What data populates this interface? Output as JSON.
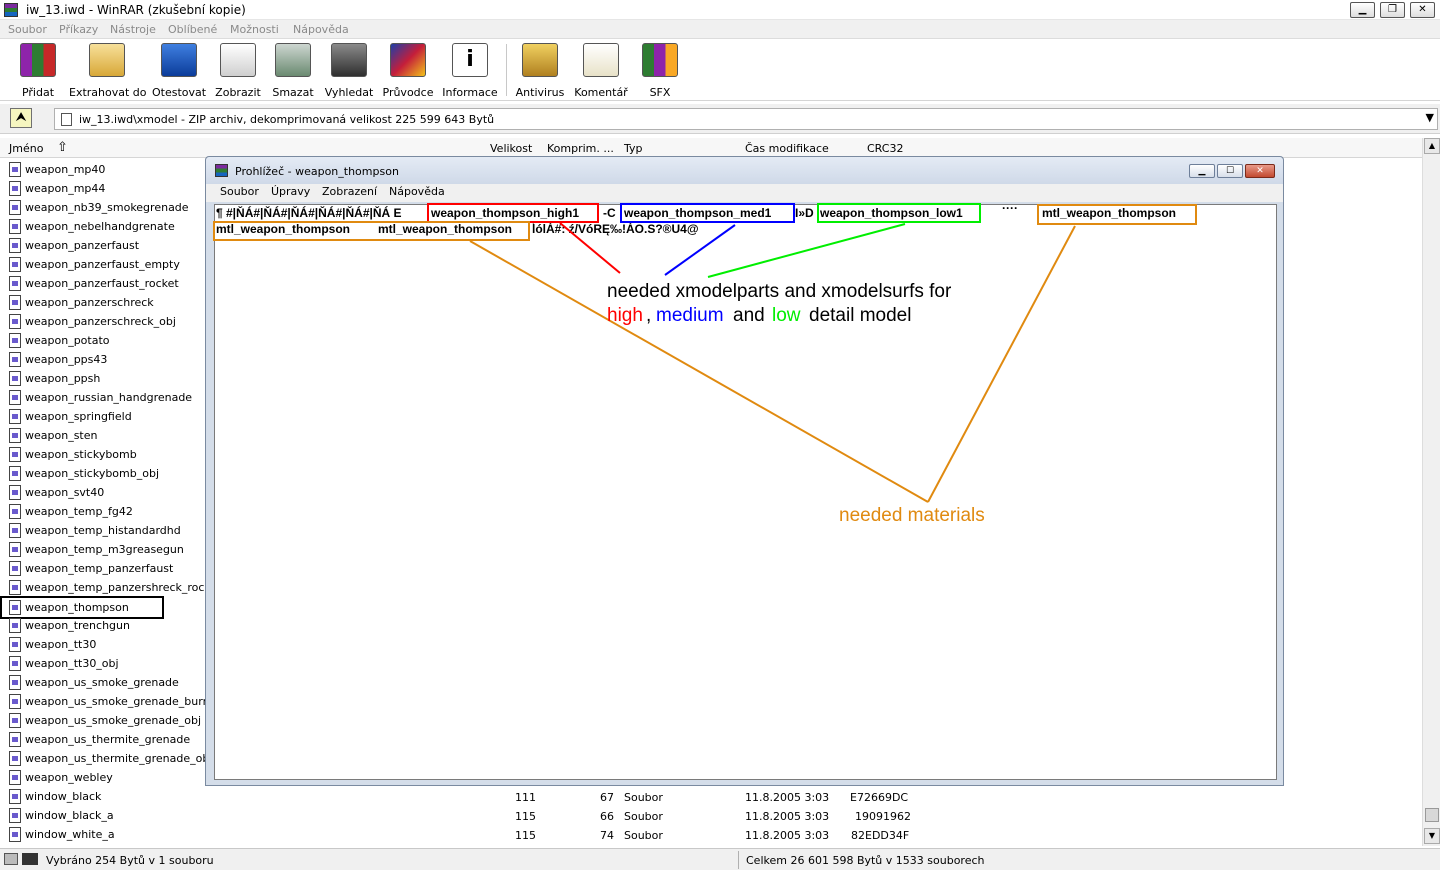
{
  "window": {
    "title": "iw_13.iwd - WinRAR (zkušební kopie)"
  },
  "menu": [
    "Soubor",
    "Příkazy",
    "Nástroje",
    "Oblíbené",
    "Možnosti",
    "Nápověda"
  ],
  "toolbar": [
    {
      "label": "Přidat",
      "icon": "add-books-icon"
    },
    {
      "label": "Extrahovat do",
      "icon": "extract-folder-icon"
    },
    {
      "label": "Otestovat",
      "icon": "test-check-icon"
    },
    {
      "label": "Zobrazit",
      "icon": "view-glasses-icon"
    },
    {
      "label": "Smazat",
      "icon": "delete-recycle-icon"
    },
    {
      "label": "Vyhledat",
      "icon": "find-binoculars-icon"
    },
    {
      "label": "Průvodce",
      "icon": "wizard-icon"
    },
    {
      "label": "Informace",
      "icon": "info-icon"
    },
    {
      "label": "Antivirus",
      "icon": "antivirus-icon"
    },
    {
      "label": "Komentář",
      "icon": "comment-pen-icon"
    },
    {
      "label": "SFX",
      "icon": "sfx-icon"
    }
  ],
  "path": {
    "text": "iw_13.iwd\\xmodel - ZIP archiv, dekomprimovaná velikost 225 599 643 Bytů"
  },
  "columns": {
    "name": "Jméno",
    "size": "Velikost",
    "packed": "Komprim. ...",
    "type": "Typ",
    "modified": "Čas modifikace",
    "crc": "CRC32"
  },
  "files": [
    "weapon_mp40",
    "weapon_mp44",
    "weapon_nb39_smokegrenade",
    "weapon_nebelhandgrenate",
    "weapon_panzerfaust",
    "weapon_panzerfaust_empty",
    "weapon_panzerfaust_rocket",
    "weapon_panzerschreck",
    "weapon_panzerschreck_obj",
    "weapon_potato",
    "weapon_pps43",
    "weapon_ppsh",
    "weapon_russian_handgrenade",
    "weapon_springfield",
    "weapon_sten",
    "weapon_stickybomb",
    "weapon_stickybomb_obj",
    "weapon_svt40",
    "weapon_temp_fg42",
    "weapon_temp_histandardhd",
    "weapon_temp_m3greasegun",
    "weapon_temp_panzerfaust",
    "weapon_temp_panzershreck_rocket",
    "weapon_thompson",
    "weapon_trenchgun",
    "weapon_tt30",
    "weapon_tt30_obj",
    "weapon_us_smoke_grenade",
    "weapon_us_smoke_grenade_burnt",
    "weapon_us_smoke_grenade_obj",
    "weapon_us_thermite_grenade",
    "weapon_us_thermite_grenade_obj",
    "weapon_webley",
    "window_black",
    "window_black_a",
    "window_white_a"
  ],
  "selected_file": "weapon_thompson",
  "file_details": [
    {
      "name": "window_black",
      "size": "111",
      "packed": "67",
      "type": "Soubor",
      "modified": "11.8.2005 3:03",
      "crc": "E72669DC"
    },
    {
      "name": "window_black_a",
      "size": "115",
      "packed": "66",
      "type": "Soubor",
      "modified": "11.8.2005 3:03",
      "crc": "19091962"
    },
    {
      "name": "window_white_a",
      "size": "115",
      "packed": "74",
      "type": "Soubor",
      "modified": "11.8.2005 3:03",
      "crc": "82EDD34F"
    }
  ],
  "status": {
    "left": "Vybráno 254 Bytů v 1 souboru",
    "right": "Celkem 26 601 598 Bytů v 1533 souborech"
  },
  "viewer": {
    "title": "Prohlížeč - weapon_thompson",
    "menu": [
      "Soubor",
      "Úpravy",
      "Zobrazení",
      "Nápověda"
    ],
    "line1": {
      "prefix": "¶ #|ŇÁ#|ŇÁ#|ŇÁ#|ŇÁ#|ŇÁ#|ŇÁ   E",
      "high": "weapon_thompson_high1",
      "mid1": "  -C",
      "med": "weapon_thompson_med1",
      "mid2": " I»D",
      "low": "weapon_thompson_low1",
      "dots": "····",
      "mtl": "mtl_weapon_thompson"
    },
    "line2": {
      "mtl1": "mtl_weapon_thompson",
      "mtl2": "mtl_weapon_thompson",
      "tail": "ĺólÁ#: ź/VóRĘ‰!ÁO.S?®U4@"
    }
  },
  "annotations": {
    "xmodel_line1": "needed xmodelparts and xmodelsurfs for",
    "high": "high",
    "comma": ",",
    "medium": "medium",
    "and": "and",
    "low": "low",
    "rest": "detail model",
    "materials": "needed materials",
    "colors": {
      "high": "#ff0000",
      "medium": "#0000ff",
      "low": "#00ee00",
      "materials": "#e08a10"
    }
  }
}
